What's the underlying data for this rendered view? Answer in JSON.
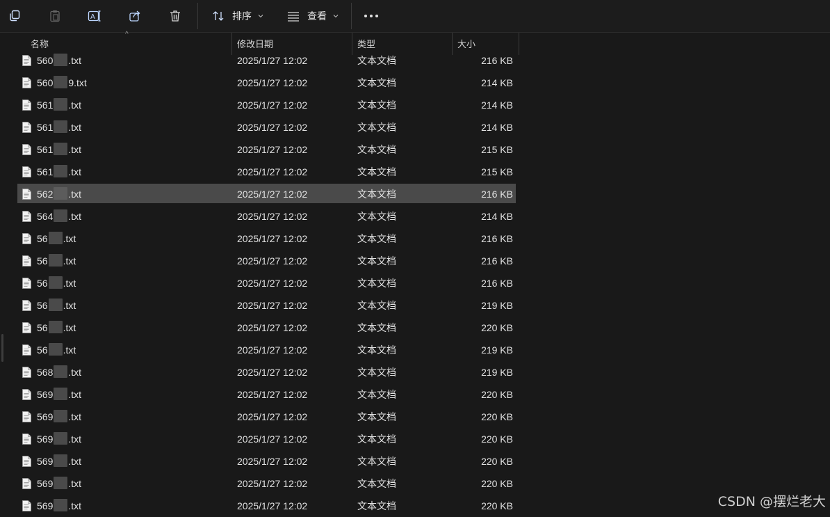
{
  "toolbar": {
    "sort_label": "排序",
    "view_label": "查看",
    "icons": [
      "copy-icon",
      "paste-icon",
      "rename-icon",
      "share-icon",
      "delete-icon",
      "sort-icon",
      "view-icon",
      "more-icon"
    ]
  },
  "columns": {
    "name": "名称",
    "date": "修改日期",
    "type": "类型",
    "size": "大小"
  },
  "files": [
    {
      "name_prefix": "560",
      "name_suffix": ".txt",
      "date": "2025/1/27 12:02",
      "type": "文本文档",
      "size": "216 KB"
    },
    {
      "name_prefix": "560",
      "name_suffix": "9.txt",
      "date": "2025/1/27 12:02",
      "type": "文本文档",
      "size": "214 KB"
    },
    {
      "name_prefix": "561",
      "name_suffix": ".txt",
      "date": "2025/1/27 12:02",
      "type": "文本文档",
      "size": "214 KB"
    },
    {
      "name_prefix": "561",
      "name_suffix": ".txt",
      "date": "2025/1/27 12:02",
      "type": "文本文档",
      "size": "214 KB"
    },
    {
      "name_prefix": "561",
      "name_suffix": ".txt",
      "date": "2025/1/27 12:02",
      "type": "文本文档",
      "size": "215 KB"
    },
    {
      "name_prefix": "561",
      "name_suffix": ".txt",
      "date": "2025/1/27 12:02",
      "type": "文本文档",
      "size": "215 KB"
    },
    {
      "name_prefix": "562",
      "name_suffix": ".txt",
      "date": "2025/1/27 12:02",
      "type": "文本文档",
      "size": "216 KB",
      "selected": true
    },
    {
      "name_prefix": "564",
      "name_suffix": ".txt",
      "date": "2025/1/27 12:02",
      "type": "文本文档",
      "size": "214 KB"
    },
    {
      "name_prefix": "56",
      "name_suffix": ".txt",
      "date": "2025/1/27 12:02",
      "type": "文本文档",
      "size": "216 KB"
    },
    {
      "name_prefix": "56",
      "name_suffix": ".txt",
      "date": "2025/1/27 12:02",
      "type": "文本文档",
      "size": "216 KB"
    },
    {
      "name_prefix": "56",
      "name_suffix": ".txt",
      "date": "2025/1/27 12:02",
      "type": "文本文档",
      "size": "216 KB"
    },
    {
      "name_prefix": "56",
      "name_suffix": ".txt",
      "date": "2025/1/27 12:02",
      "type": "文本文档",
      "size": "219 KB"
    },
    {
      "name_prefix": "56",
      "name_suffix": ".txt",
      "date": "2025/1/27 12:02",
      "type": "文本文档",
      "size": "220 KB"
    },
    {
      "name_prefix": "56",
      "name_suffix": ".txt",
      "date": "2025/1/27 12:02",
      "type": "文本文档",
      "size": "219 KB"
    },
    {
      "name_prefix": "568",
      "name_suffix": ".txt",
      "date": "2025/1/27 12:02",
      "type": "文本文档",
      "size": "219 KB"
    },
    {
      "name_prefix": "569",
      "name_suffix": ".txt",
      "date": "2025/1/27 12:02",
      "type": "文本文档",
      "size": "220 KB"
    },
    {
      "name_prefix": "569",
      "name_suffix": ".txt",
      "date": "2025/1/27 12:02",
      "type": "文本文档",
      "size": "220 KB"
    },
    {
      "name_prefix": "569",
      "name_suffix": ".txt",
      "date": "2025/1/27 12:02",
      "type": "文本文档",
      "size": "220 KB"
    },
    {
      "name_prefix": "569",
      "name_suffix": ".txt",
      "date": "2025/1/27 12:02",
      "type": "文本文档",
      "size": "220 KB"
    },
    {
      "name_prefix": "569",
      "name_suffix": ".txt",
      "date": "2025/1/27 12:02",
      "type": "文本文档",
      "size": "220 KB"
    },
    {
      "name_prefix": "569",
      "name_suffix": ".txt",
      "date": "2025/1/27 12:02",
      "type": "文本文档",
      "size": "220 KB"
    }
  ],
  "watermark": "CSDN @摆烂老大"
}
